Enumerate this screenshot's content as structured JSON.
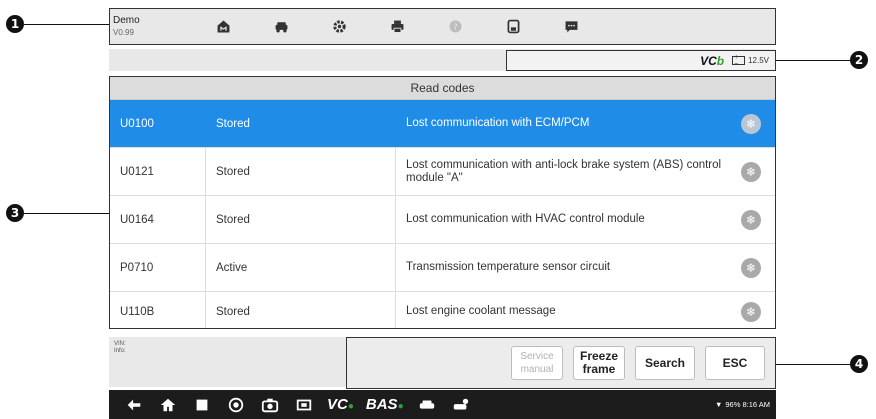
{
  "app": {
    "name": "Demo",
    "version": "V0.99"
  },
  "toolbar": {
    "icons": [
      "home-icon",
      "vehicle-swap-icon",
      "gear-icon",
      "printer-icon",
      "help-icon",
      "save-icon",
      "message-icon"
    ]
  },
  "status": {
    "vci_label_main": "VC",
    "vci_label_accent": "b",
    "battery_voltage": "12.5V"
  },
  "table": {
    "title": "Read codes",
    "rows": [
      {
        "code": "U0100",
        "status": "Stored",
        "description": "Lost communication with ECM/PCM",
        "selected": true
      },
      {
        "code": "U0121",
        "status": "Stored",
        "description": "Lost communication with anti-lock brake system (ABS) control module \"A\""
      },
      {
        "code": "U0164",
        "status": "Stored",
        "description": "Lost communication with HVAC control module"
      },
      {
        "code": "P0710",
        "status": "Active",
        "description": "Transmission temperature sensor circuit"
      },
      {
        "code": "U110B",
        "status": "Stored",
        "description": "Lost engine coolant message"
      }
    ]
  },
  "vehicle": {
    "vin_label": "VIN:",
    "info_label": "Info:"
  },
  "actions": {
    "service_manual": "Service manual",
    "freeze_frame": "Freeze frame",
    "search": "Search",
    "esc": "ESC"
  },
  "callouts": [
    "1",
    "2",
    "3",
    "4"
  ],
  "navbar": {
    "vci_text": "VC",
    "bas_text": "BAS",
    "system_status": "96% 8:16 AM"
  },
  "colors": {
    "selected_row": "#1f8ce8",
    "toolbar_bg": "#e8e8e8",
    "navbar_bg": "#1c1c1c",
    "vci_accent": "#2fa52f"
  }
}
